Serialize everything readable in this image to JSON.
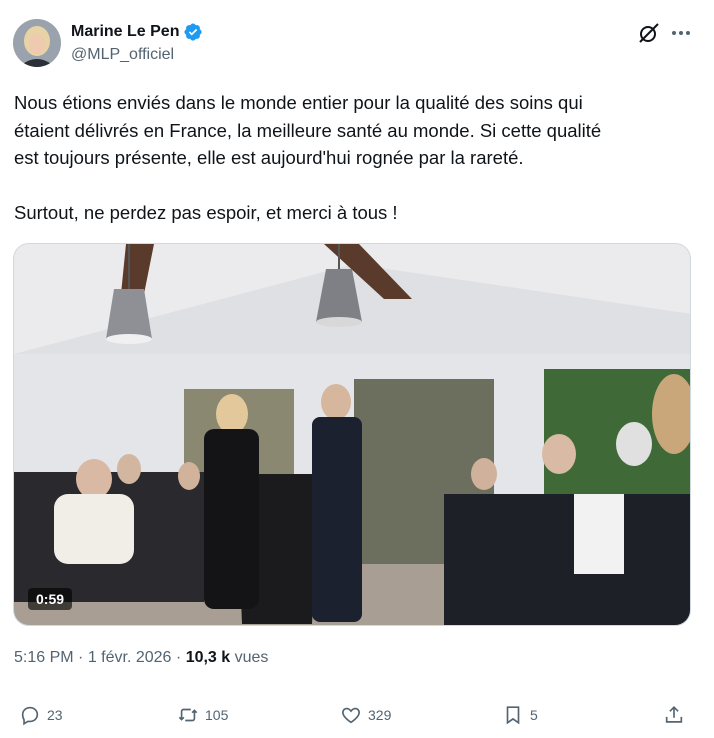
{
  "author": {
    "display_name": "Marine Le Pen",
    "handle": "@MLP_officiel",
    "verified": true
  },
  "tweet": {
    "lines": [
      "Nous étions enviés dans le monde entier pour la qualité des soins qui",
      "étaient délivrés en France, la meilleure santé au monde. Si cette qualité",
      "est toujours présente, elle est aujourd'hui rognée par la rareté.",
      "Surtout, ne perdez pas espoir, et merci à tous !"
    ]
  },
  "media": {
    "type": "video",
    "duration": "0:59"
  },
  "meta": {
    "time": "5:16 PM",
    "separator": "·",
    "date": "1 févr. 2026",
    "separator2": "·",
    "views_count": "10,3 k",
    "views_label": "vues"
  },
  "actions": {
    "replies": "23",
    "reposts": "105",
    "likes": "329",
    "bookmarks": "5"
  },
  "colors": {
    "text": "#0f1419",
    "secondary": "#536471",
    "verified": "#1d9bf0"
  },
  "icons": [
    "verified-badge-icon",
    "grok-icon",
    "more-icon",
    "reply-icon",
    "repost-icon",
    "like-icon",
    "bookmark-icon",
    "share-icon"
  ]
}
